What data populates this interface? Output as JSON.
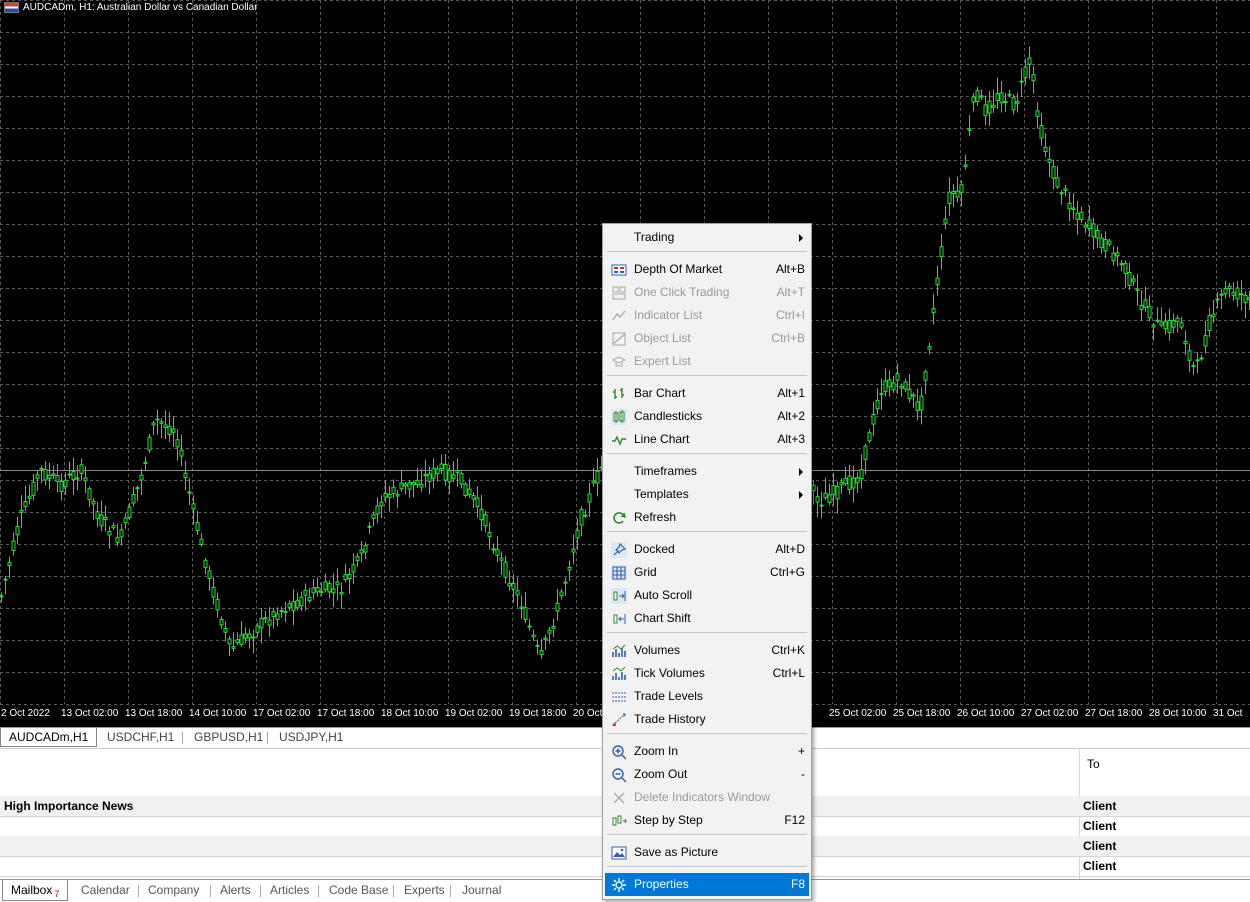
{
  "chart": {
    "title": "AUDCADm, H1:  Australian Dollar vs Canadian Dollar",
    "x_labels": [
      "2 Oct 2022",
      "13 Oct 02:00",
      "13 Oct 18:00",
      "14 Oct 10:00",
      "17 Oct 02:00",
      "17 Oct 18:00",
      "18 Oct 10:00",
      "19 Oct 02:00",
      "19 Oct 18:00",
      "20 Oct",
      "25 Oct 02:00",
      "25 Oct 18:00",
      "26 Oct 10:00",
      "27 Oct 02:00",
      "27 Oct 18:00",
      "28 Oct 10:00",
      "31 Oct"
    ],
    "colors": {
      "background": "#000000",
      "grid": "#5a5a5a",
      "candles": "#22e52b",
      "price_line": "#8a8a8a"
    }
  },
  "chart_tabs": [
    "AUDCADm,H1",
    "USDCHF,H1",
    "GBPUSD,H1",
    "USDJPY,H1"
  ],
  "toolbox": {
    "column_header": "To",
    "rows": [
      {
        "left": "High Importance News",
        "right": "Client"
      },
      {
        "left": "",
        "right": "Client"
      },
      {
        "left": "",
        "right": "Client"
      },
      {
        "left": "",
        "right": "Client"
      }
    ]
  },
  "bottom_tabs": {
    "mailbox_label": "Mailbox",
    "mailbox_badge": "7",
    "items": [
      "Calendar",
      "Company",
      "Alerts",
      "Articles",
      "Code Base",
      "Experts",
      "Journal"
    ]
  },
  "context_menu": {
    "items": [
      {
        "label": "Trading",
        "shortcut": "",
        "icon": "none",
        "submenu": true,
        "disabled": false
      },
      {
        "label": "Depth Of Market",
        "shortcut": "Alt+B",
        "icon": "depth-of-market-icon",
        "submenu": false,
        "disabled": false
      },
      {
        "label": "One Click Trading",
        "shortcut": "Alt+T",
        "icon": "one-click-trading-icon",
        "submenu": false,
        "disabled": true
      },
      {
        "label": "Indicator List",
        "shortcut": "Ctrl+I",
        "icon": "indicator-list-icon",
        "submenu": false,
        "disabled": true
      },
      {
        "label": "Object List",
        "shortcut": "Ctrl+B",
        "icon": "object-list-icon",
        "submenu": false,
        "disabled": true
      },
      {
        "label": "Expert List",
        "shortcut": "",
        "icon": "expert-list-icon",
        "submenu": false,
        "disabled": true
      },
      {
        "label": "Bar Chart",
        "shortcut": "Alt+1",
        "icon": "bar-chart-icon",
        "submenu": false,
        "disabled": false
      },
      {
        "label": "Candlesticks",
        "shortcut": "Alt+2",
        "icon": "candlesticks-icon",
        "submenu": false,
        "disabled": false
      },
      {
        "label": "Line Chart",
        "shortcut": "Alt+3",
        "icon": "line-chart-icon",
        "submenu": false,
        "disabled": false
      },
      {
        "label": "Timeframes",
        "shortcut": "",
        "icon": "none",
        "submenu": true,
        "disabled": false
      },
      {
        "label": "Templates",
        "shortcut": "",
        "icon": "none",
        "submenu": true,
        "disabled": false
      },
      {
        "label": "Refresh",
        "shortcut": "",
        "icon": "refresh-icon",
        "submenu": false,
        "disabled": false
      },
      {
        "label": "Docked",
        "shortcut": "Alt+D",
        "icon": "pin-icon",
        "submenu": false,
        "disabled": false
      },
      {
        "label": "Grid",
        "shortcut": "Ctrl+G",
        "icon": "grid-icon",
        "submenu": false,
        "disabled": false
      },
      {
        "label": "Auto Scroll",
        "shortcut": "",
        "icon": "auto-scroll-icon",
        "submenu": false,
        "disabled": false
      },
      {
        "label": "Chart Shift",
        "shortcut": "",
        "icon": "chart-shift-icon",
        "submenu": false,
        "disabled": false
      },
      {
        "label": "Volumes",
        "shortcut": "Ctrl+K",
        "icon": "volumes-icon",
        "submenu": false,
        "disabled": false
      },
      {
        "label": "Tick Volumes",
        "shortcut": "Ctrl+L",
        "icon": "tick-volumes-icon",
        "submenu": false,
        "disabled": false
      },
      {
        "label": "Trade Levels",
        "shortcut": "",
        "icon": "trade-levels-icon",
        "submenu": false,
        "disabled": false
      },
      {
        "label": "Trade History",
        "shortcut": "",
        "icon": "trade-history-icon",
        "submenu": false,
        "disabled": false
      },
      {
        "label": "Zoom In",
        "shortcut": "+",
        "icon": "zoom-in-icon",
        "submenu": false,
        "disabled": false
      },
      {
        "label": "Zoom Out",
        "shortcut": "-",
        "icon": "zoom-out-icon",
        "submenu": false,
        "disabled": false
      },
      {
        "label": "Delete Indicators Window",
        "shortcut": "",
        "icon": "close-icon",
        "submenu": false,
        "disabled": true
      },
      {
        "label": "Step by Step",
        "shortcut": "F12",
        "icon": "step-by-step-icon",
        "submenu": false,
        "disabled": false
      },
      {
        "label": "Save as Picture",
        "shortcut": "",
        "icon": "save-picture-icon",
        "submenu": false,
        "disabled": false
      },
      {
        "label": "Properties",
        "shortcut": "F8",
        "icon": "gear-icon",
        "submenu": false,
        "disabled": false,
        "highlighted": true
      }
    ]
  }
}
